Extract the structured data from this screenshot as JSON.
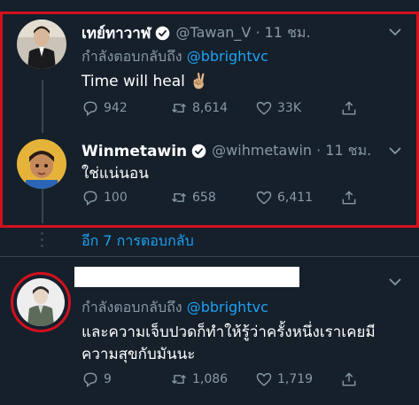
{
  "tweets": [
    {
      "name": "เทย์ทาวาฬ",
      "handle_time": "@Tawan_V · 11 ชม.",
      "reply_prefix": "กำลังตอบกลับถึง",
      "reply_to": "@bbrightvc",
      "text": "Time will heal ✌🏼",
      "replies": "942",
      "retweets": "8,614",
      "likes": "33K"
    },
    {
      "name": "Winmetawin",
      "handle_time": "@wihmetawin · 11 ชม.",
      "text": "ใช่แน่นอน",
      "replies": "100",
      "retweets": "658",
      "likes": "6,411"
    },
    {
      "name": "",
      "reply_prefix": "กำลังตอบกลับถึง",
      "reply_to": "@bbrightvc",
      "text_line1": "และความเจ็บปวดก็ทำให้รู้ว่าครั้งหนึ่งเราเคยมี",
      "text_line2": "ความสุขกับมันนะ",
      "replies": "9",
      "retweets": "1,086",
      "likes": "1,719"
    }
  ],
  "more_replies": "อีก 7 การตอบกลับ",
  "colors": {
    "background": "#15202b",
    "link": "#1da1f2",
    "muted": "#8899a6",
    "highlight": "#d4101e",
    "retweet": "#8899a6"
  },
  "icons": [
    "verified-badge-icon",
    "reply-icon",
    "retweet-icon",
    "like-icon",
    "share-icon",
    "chevron-down-icon"
  ]
}
